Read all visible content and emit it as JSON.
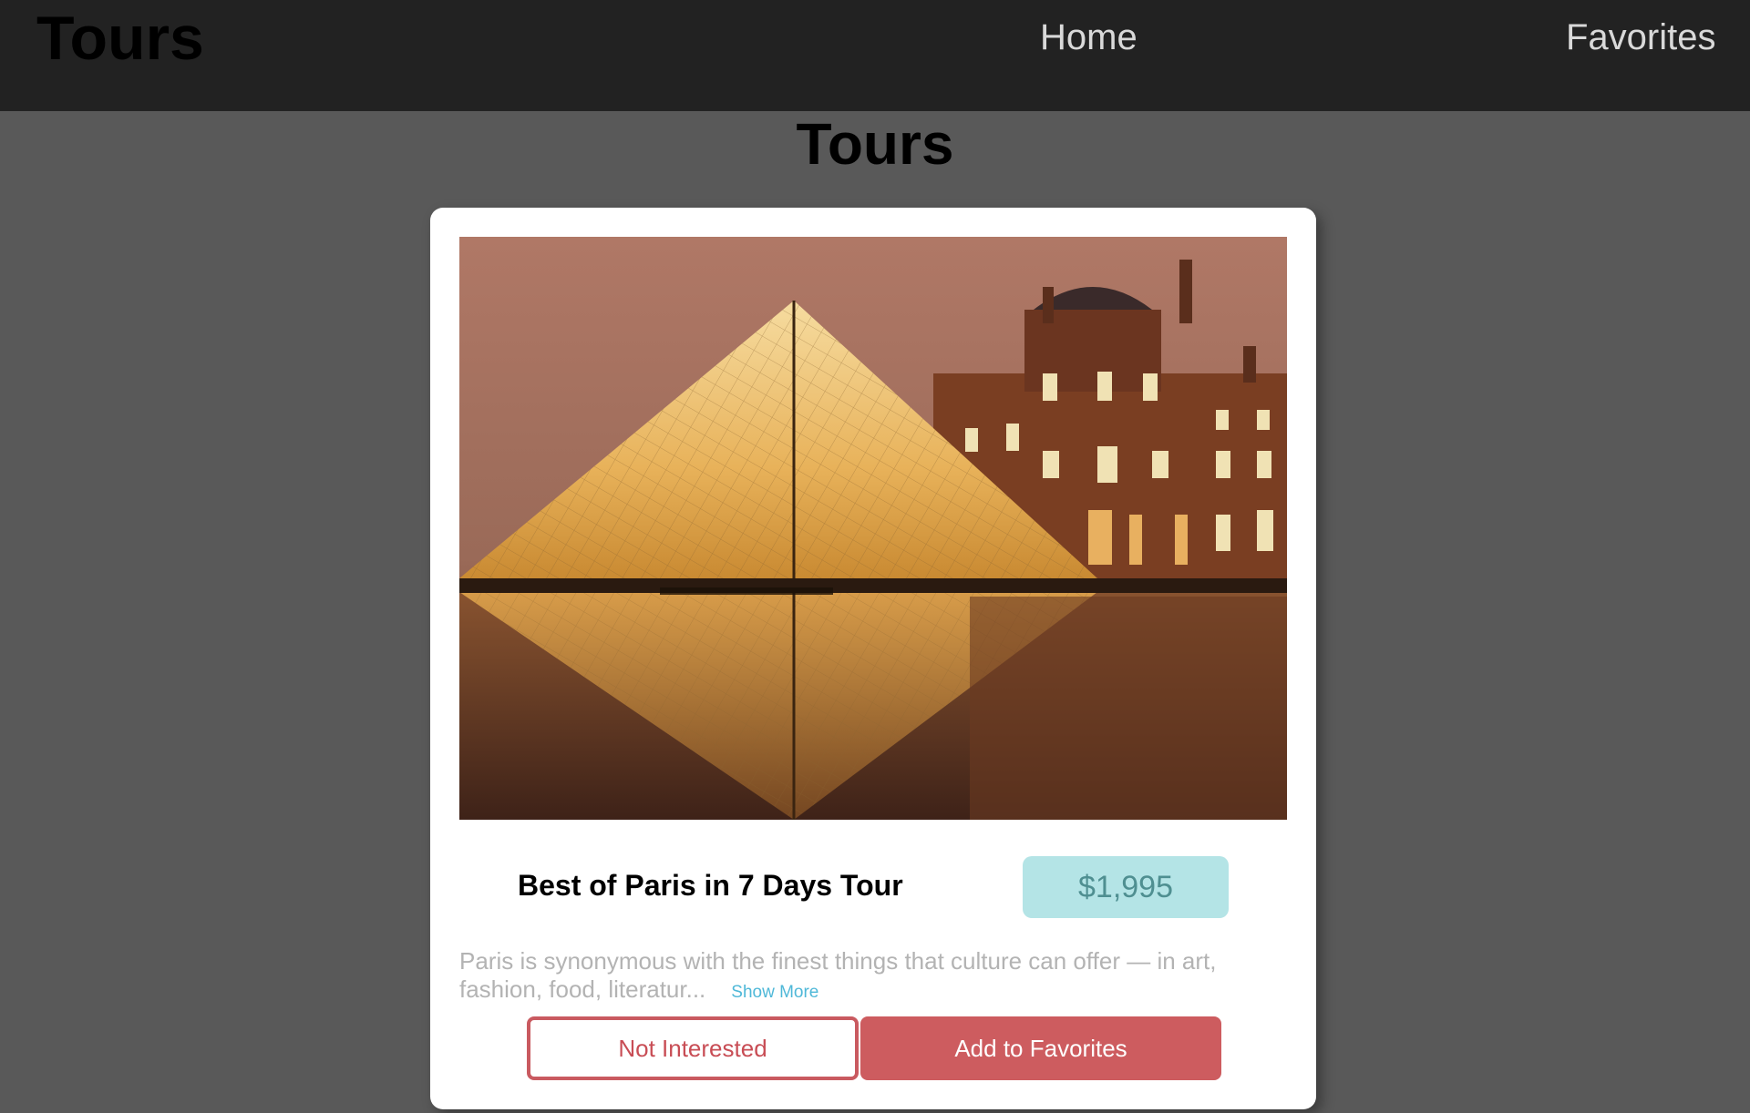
{
  "navbar": {
    "brand": "Tours",
    "links": [
      {
        "label": "Home"
      },
      {
        "label": "Favorites"
      }
    ]
  },
  "page": {
    "title": "Tours"
  },
  "tour": {
    "name": "Best of Paris in 7 Days Tour",
    "price": "$1,995",
    "description": "Paris is synonymous with the finest things that culture can offer — in art, fashion, food, literatur...",
    "show_more_label": "Show More",
    "image_subject": "Louvre pyramid illuminated at night"
  },
  "actions": {
    "not_interested_label": "Not Interested",
    "add_favorites_label": "Add to Favorites"
  },
  "colors": {
    "navbar_bg": "#222222",
    "page_bg": "#595959",
    "price_bg": "#b4e4e6",
    "price_text": "#4f8f91",
    "accent_red": "#cd5c5f",
    "link_blue": "#4fb8d8"
  }
}
